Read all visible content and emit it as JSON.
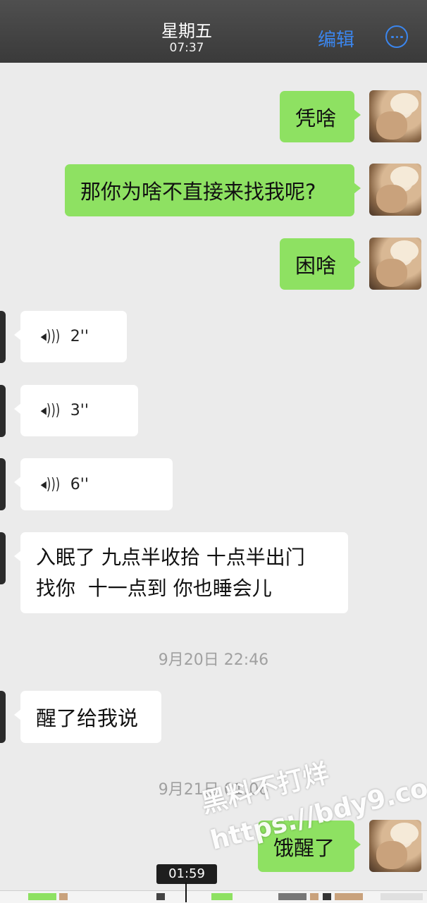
{
  "header": {
    "title": "星期五",
    "time": "07:37",
    "edit_label": "编辑",
    "more_icon": "ellipsis-circle-icon"
  },
  "messages": [
    {
      "side": "out",
      "text": "凭啥"
    },
    {
      "side": "out",
      "text": "那你为啥不直接来找我呢?"
    },
    {
      "side": "out",
      "text": "困啥"
    },
    {
      "side": "in",
      "type": "voice",
      "duration": "2''"
    },
    {
      "side": "in",
      "type": "voice",
      "duration": "3''"
    },
    {
      "side": "in",
      "type": "voice",
      "duration": "6''"
    },
    {
      "side": "in",
      "text_line1": "入眠了 九点半收拾 十点半出门",
      "text_line2": "找你  十一点到 你也睡会儿"
    },
    {
      "timestamp": "9月20日 22:46"
    },
    {
      "side": "in",
      "text": "醒了给我说"
    },
    {
      "timestamp": "9月21日 01:06"
    },
    {
      "side": "out",
      "text": "饿醒了"
    }
  ],
  "watermark": {
    "line1": "黑料不打烊",
    "line2": "https://bdy9.co"
  },
  "player": {
    "current_time": "01:59"
  },
  "colors": {
    "outgoing_bubble": "#8ee162",
    "incoming_bubble": "#ffffff",
    "background": "#ebebeb",
    "accent": "#3b86ee"
  }
}
